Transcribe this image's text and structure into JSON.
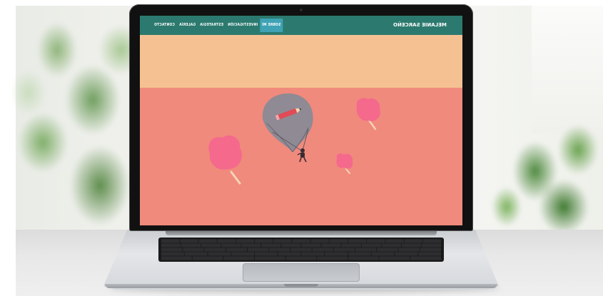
{
  "site": {
    "brand": "MELANIE SARCEÑO",
    "nav": [
      {
        "label": "CONTACTO",
        "active": false
      },
      {
        "label": "GALERÍA",
        "active": false
      },
      {
        "label": "ESTRATEGIA",
        "active": false
      },
      {
        "label": "INVESTIGACIÓN",
        "active": false
      },
      {
        "label": "SOBRE MÍ",
        "active": true
      }
    ]
  },
  "colors": {
    "navbar": "#2c7a6f",
    "nav_active": "#3fa2b5",
    "band_top": "#f6c192",
    "band_main": "#f08a7c",
    "balloon": "#8f8a94",
    "trees": "#f27a9a"
  },
  "illustration": {
    "balloon_icon": "parachute-balloon-icon",
    "pencil_icon": "pencil-icon",
    "tree_icon": "pink-tree-icon",
    "figure_icon": "person-hanging-icon"
  }
}
